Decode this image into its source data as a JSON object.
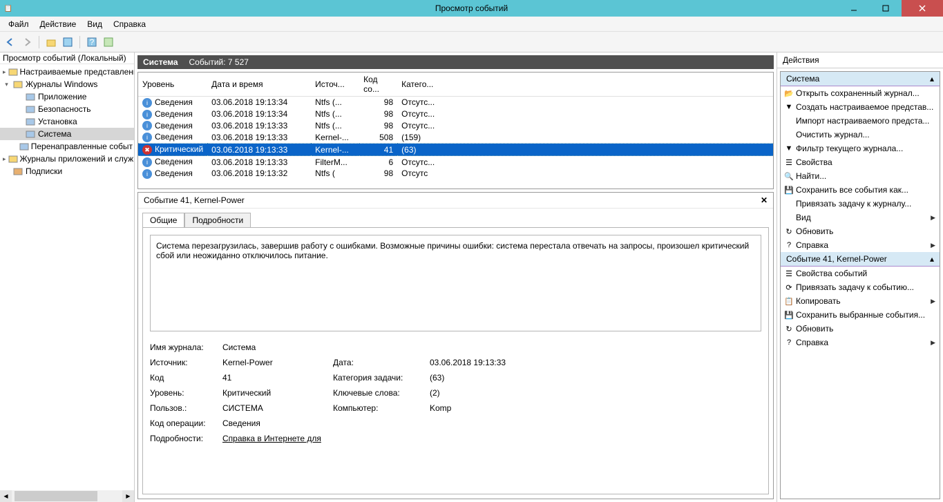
{
  "window": {
    "title": "Просмотр событий"
  },
  "menu": [
    "Файл",
    "Действие",
    "Вид",
    "Справка"
  ],
  "tree": {
    "header": "Просмотр событий (Локальный)",
    "items": [
      {
        "label": "Настраиваемые представлени",
        "icon": "folder",
        "indent": 0,
        "exp": "▸"
      },
      {
        "label": "Журналы Windows",
        "icon": "folder",
        "indent": 0,
        "exp": "▾"
      },
      {
        "label": "Приложение",
        "icon": "log",
        "indent": 1
      },
      {
        "label": "Безопасность",
        "icon": "log",
        "indent": 1
      },
      {
        "label": "Установка",
        "icon": "log",
        "indent": 1
      },
      {
        "label": "Система",
        "icon": "log",
        "indent": 1,
        "selected": true
      },
      {
        "label": "Перенаправленные событ",
        "icon": "log",
        "indent": 1
      },
      {
        "label": "Журналы приложений и служ",
        "icon": "folder",
        "indent": 0,
        "exp": "▸"
      },
      {
        "label": "Подписки",
        "icon": "sub",
        "indent": 0
      }
    ]
  },
  "main": {
    "title": "Система",
    "count_label": "Событий: 7 527",
    "columns": [
      "Уровень",
      "Дата и время",
      "Источ...",
      "Код со...",
      "Катего..."
    ],
    "rows": [
      {
        "level": "Сведения",
        "icon": "info",
        "dt": "03.06.2018 19:13:34",
        "src": "Ntfs (...",
        "code": "98",
        "cat": "Отсутс..."
      },
      {
        "level": "Сведения",
        "icon": "info",
        "dt": "03.06.2018 19:13:34",
        "src": "Ntfs (...",
        "code": "98",
        "cat": "Отсутс..."
      },
      {
        "level": "Сведения",
        "icon": "info",
        "dt": "03.06.2018 19:13:33",
        "src": "Ntfs (...",
        "code": "98",
        "cat": "Отсутс..."
      },
      {
        "level": "Сведения",
        "icon": "info",
        "dt": "03.06.2018 19:13:33",
        "src": "Kernel-...",
        "code": "508",
        "cat": "(159)"
      },
      {
        "level": "Критический",
        "icon": "crit",
        "dt": "03.06.2018 19:13:33",
        "src": "Kernel-...",
        "code": "41",
        "cat": "(63)",
        "selected": true
      },
      {
        "level": "Сведения",
        "icon": "info",
        "dt": "03.06.2018 19:13:33",
        "src": "FilterM...",
        "code": "6",
        "cat": "Отсутс..."
      },
      {
        "level": "Сведения",
        "icon": "info",
        "dt": "03.06.2018 19:13:32",
        "src": "Ntfs (",
        "code": "98",
        "cat": "Отсутс"
      }
    ]
  },
  "detail": {
    "header": "Событие 41, Kernel-Power",
    "tabs": [
      "Общие",
      "Подробности"
    ],
    "description": "Система перезагрузилась, завершив работу с ошибками. Возможные причины ошибки: система перестала отвечать на запросы, произошел критический сбой или неожиданно отключилось питание.",
    "fields": {
      "log_name_lbl": "Имя журнала:",
      "log_name": "Система",
      "source_lbl": "Источник:",
      "source": "Kernel-Power",
      "date_lbl": "Дата:",
      "date": "03.06.2018 19:13:33",
      "code_lbl": "Код",
      "code": "41",
      "task_cat_lbl": "Категория задачи:",
      "task_cat": "(63)",
      "level_lbl": "Уровень:",
      "level": "Критический",
      "keywords_lbl": "Ключевые слова:",
      "keywords": "(2)",
      "user_lbl": "Пользов.:",
      "user": "СИСТЕМА",
      "computer_lbl": "Компьютер:",
      "computer": "Komp",
      "opcode_lbl": "Код операции:",
      "opcode": "Сведения",
      "details_lbl": "Подробности:",
      "details_link": "Справка в Интернете для "
    }
  },
  "actions": {
    "title": "Действия",
    "section1": "Система",
    "items1": [
      {
        "icon": "📂",
        "label": "Открыть сохраненный журнал..."
      },
      {
        "icon": "▼",
        "label": "Создать настраиваемое представ..."
      },
      {
        "icon": "",
        "label": "Импорт настраиваемого предста..."
      },
      {
        "icon": "",
        "label": "Очистить журнал..."
      },
      {
        "icon": "▼",
        "label": "Фильтр текущего журнала..."
      },
      {
        "icon": "☰",
        "label": "Свойства"
      },
      {
        "icon": "🔍",
        "label": "Найти..."
      },
      {
        "icon": "💾",
        "label": "Сохранить все события как..."
      },
      {
        "icon": "",
        "label": "Привязать задачу к журналу..."
      },
      {
        "icon": "",
        "label": "Вид",
        "arrow": true
      },
      {
        "icon": "↻",
        "label": "Обновить"
      },
      {
        "icon": "?",
        "label": "Справка",
        "arrow": true
      }
    ],
    "section2": "Событие 41, Kernel-Power",
    "items2": [
      {
        "icon": "☰",
        "label": "Свойства событий"
      },
      {
        "icon": "⟳",
        "label": "Привязать задачу к событию..."
      },
      {
        "icon": "📋",
        "label": "Копировать",
        "arrow": true
      },
      {
        "icon": "💾",
        "label": "Сохранить выбранные события..."
      },
      {
        "icon": "↻",
        "label": "Обновить"
      },
      {
        "icon": "?",
        "label": "Справка",
        "arrow": true
      }
    ]
  }
}
